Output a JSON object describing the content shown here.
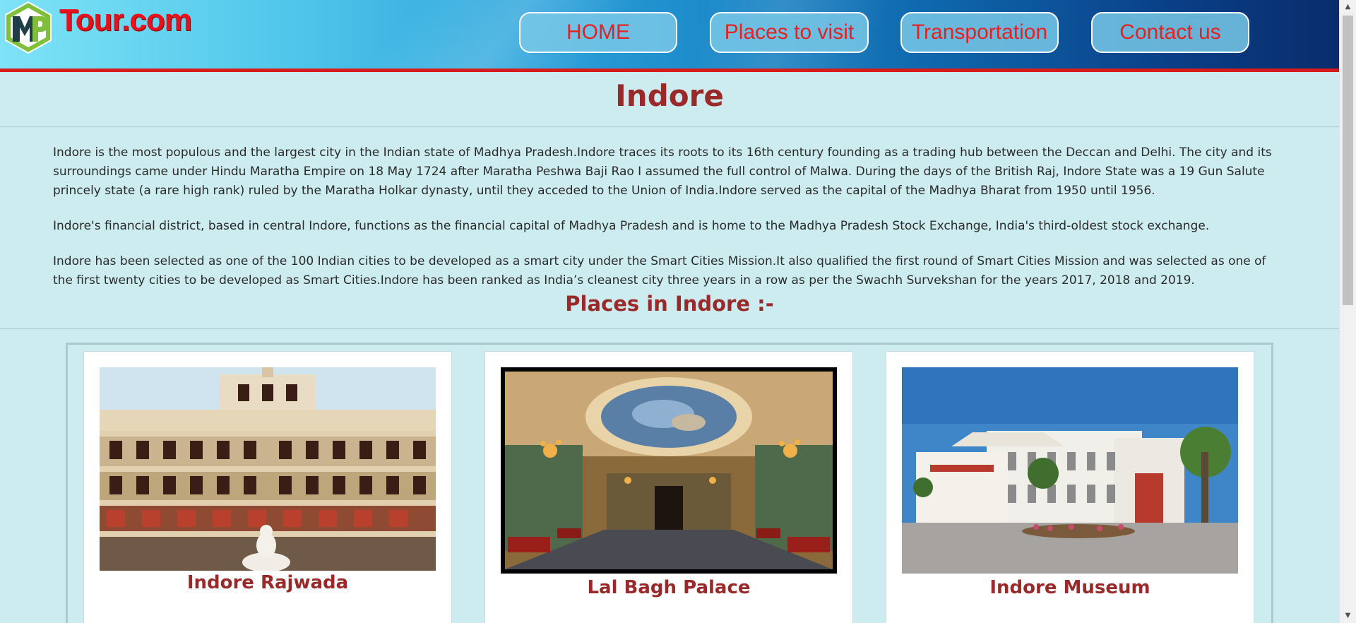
{
  "header": {
    "logo_text": "Tour.com",
    "logo_badge": "MP",
    "nav": [
      {
        "label": "HOME"
      },
      {
        "label": "Places to visit"
      },
      {
        "label": "Transportation"
      },
      {
        "label": "Contact us"
      }
    ]
  },
  "main": {
    "title": "Indore",
    "paragraphs": [
      "Indore is the most populous and the largest city in the Indian state of Madhya Pradesh.Indore traces its roots to its 16th century founding as a trading hub between the Deccan and Delhi. The city and its surroundings came under Hindu Maratha Empire on 18 May 1724 after Maratha Peshwa Baji Rao I assumed the full control of Malwa. During the days of the British Raj, Indore State was a 19 Gun Salute princely state (a rare high rank) ruled by the Maratha Holkar dynasty, until they acceded to the Union of India.Indore served as the capital of the Madhya Bharat from 1950 until 1956.",
      "Indore's financial district, based in central Indore, functions as the financial capital of Madhya Pradesh and is home to the Madhya Pradesh Stock Exchange, India's third-oldest stock exchange.",
      "Indore has been selected as one of the 100 Indian cities to be developed as a smart city under the Smart Cities Mission.It also qualified the first round of Smart Cities Mission and was selected as one of the first twenty cities to be developed as Smart Cities.Indore has been ranked as India’s cleanest city three years in a row as per the Swachh Survekshan for the years 2017, 2018 and 2019."
    ],
    "places_heading": "Places in Indore :-",
    "places": [
      {
        "name": "Indore Rajwada"
      },
      {
        "name": "Lal Bagh Palace"
      },
      {
        "name": "Indore Museum"
      }
    ]
  },
  "colors": {
    "accent_red": "#d81b1b",
    "heading": "#9a2a2a",
    "background": "#cdecf0"
  }
}
